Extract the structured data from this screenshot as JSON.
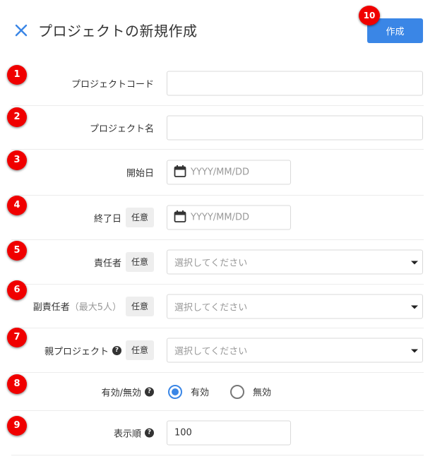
{
  "header": {
    "title": "プロジェクトの新規作成",
    "create_label": "作成",
    "close_icon": "close-icon"
  },
  "badges": [
    "1",
    "2",
    "3",
    "4",
    "5",
    "6",
    "7",
    "8",
    "9",
    "10"
  ],
  "optional_label": "任意",
  "help_glyph": "?",
  "fields": {
    "project_code": {
      "label": "プロジェクトコード",
      "value": ""
    },
    "project_name": {
      "label": "プロジェクト名",
      "value": ""
    },
    "start_date": {
      "label": "開始日",
      "placeholder": "YYYY/MM/DD",
      "icon": "calendar-icon"
    },
    "end_date": {
      "label": "終了日",
      "placeholder": "YYYY/MM/DD",
      "icon": "calendar-icon"
    },
    "owner": {
      "label": "責任者",
      "placeholder": "選択してください"
    },
    "sub_owner": {
      "label": "副責任者",
      "sub_label": "（最大5人）",
      "placeholder": "選択してください"
    },
    "parent_project": {
      "label": "親プロジェクト",
      "placeholder": "選択してください"
    },
    "status": {
      "label": "有効/無効",
      "options": [
        "有効",
        "無効"
      ],
      "selected": "有効"
    },
    "display_order": {
      "label": "表示順",
      "value": "100"
    }
  },
  "colors": {
    "accent": "#3a86e6",
    "badge": "#f00000"
  }
}
